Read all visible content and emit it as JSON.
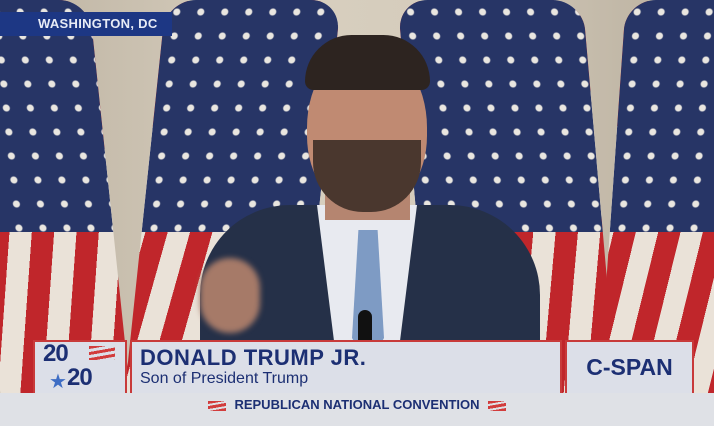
{
  "location": "WASHINGTON, DC",
  "logo": {
    "year_top": "20",
    "year_bottom": "20"
  },
  "speaker": {
    "name": "DONALD TRUMP JR.",
    "title": "Son of President Trump"
  },
  "network": "C-SPAN",
  "event": "REPUBLICAN NATIONAL CONVENTION",
  "colors": {
    "navy": "#1c2f73",
    "red": "#c83a3a",
    "panel": "#dcdfe8"
  }
}
